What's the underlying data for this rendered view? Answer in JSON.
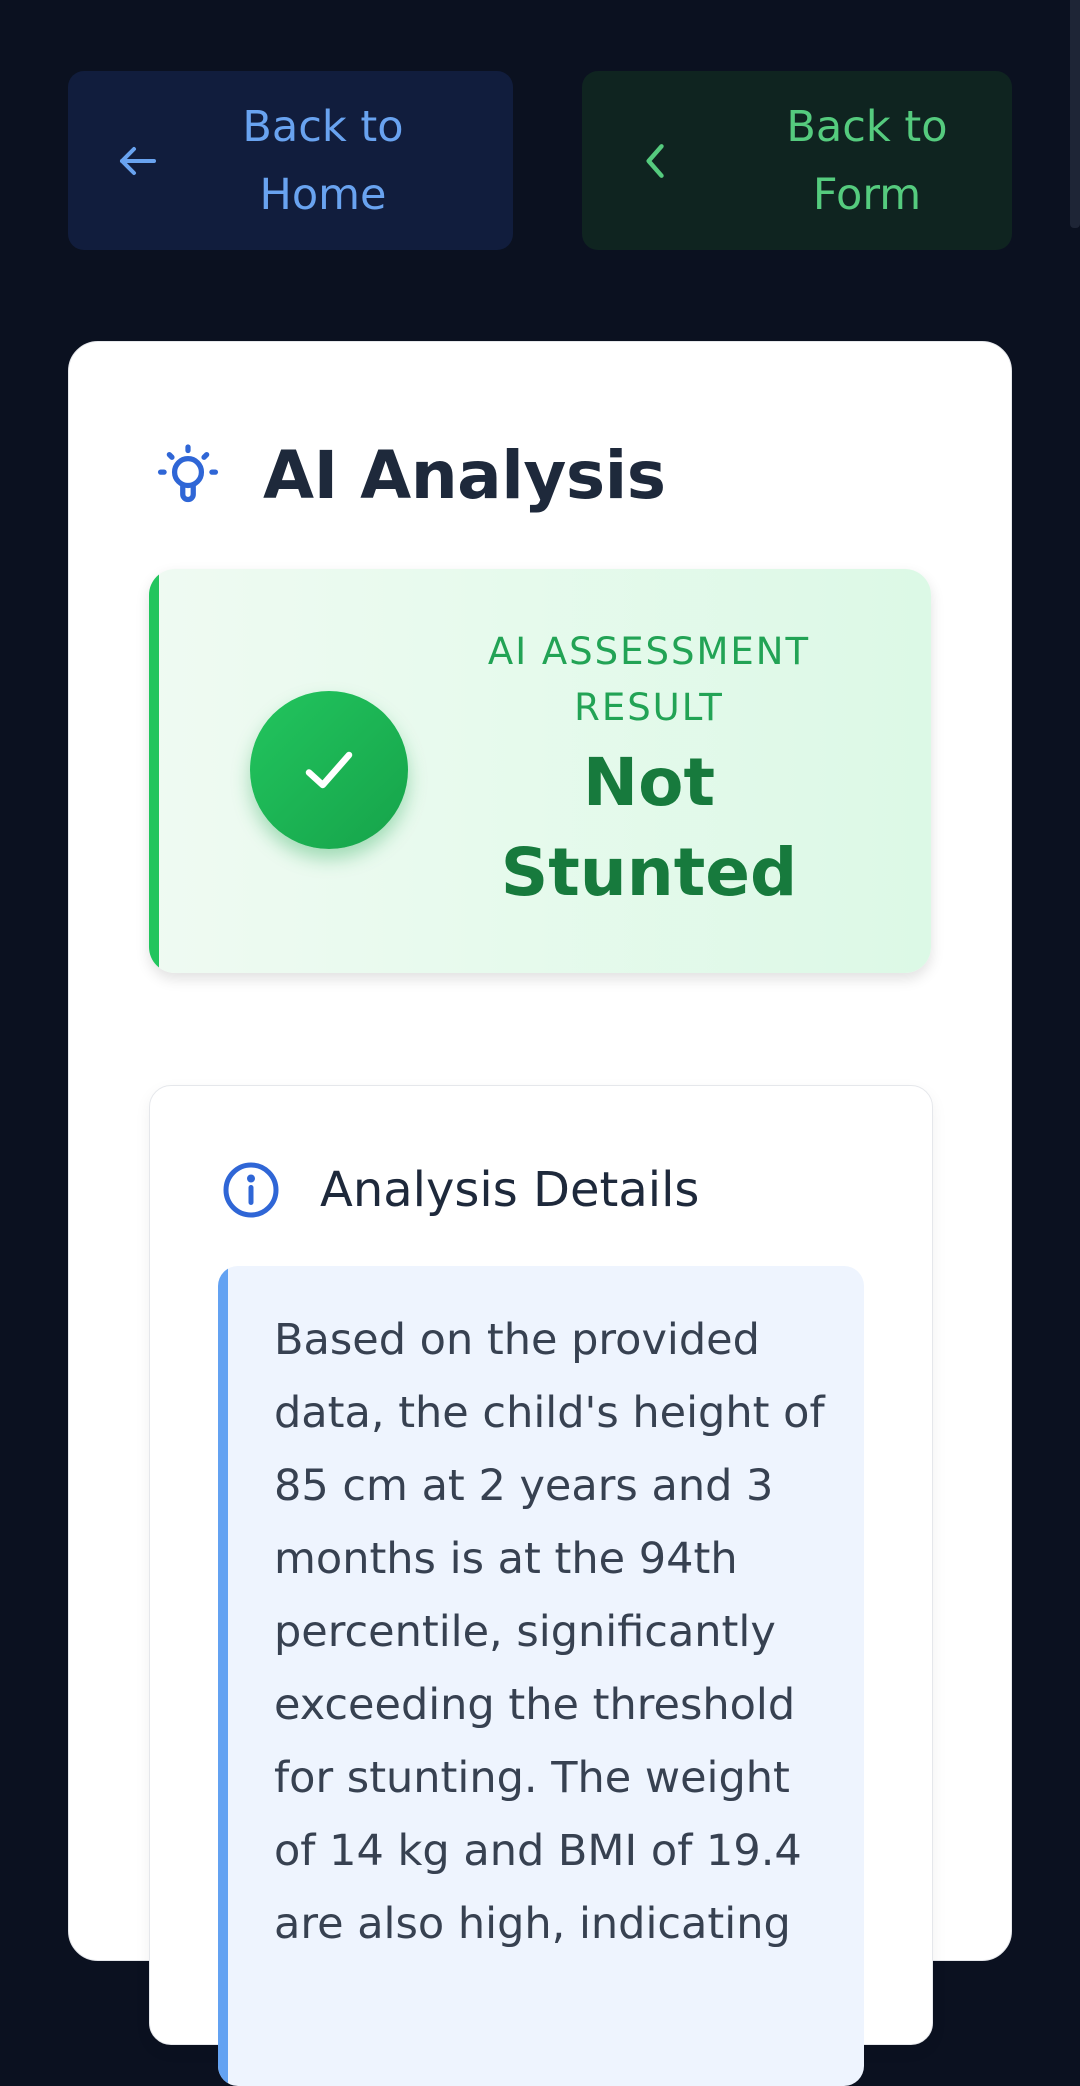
{
  "nav": {
    "back_home_label": "Back to Home",
    "back_form_label": "Back to Form"
  },
  "analysis": {
    "title": "AI Analysis",
    "result_label": "AI ASSESSMENT RESULT",
    "result_value": "Not Stunted",
    "details_title": "Analysis Details",
    "details_text": "Based on the provided data, the child's height of 85 cm at 2 years and 3 months is at the 94th percentile, significantly exceeding the threshold for stunting. The weight of 14 kg and BMI of 19.4 are also high, indicating"
  },
  "icons": {
    "back_home": "arrow-left-icon",
    "back_form": "chevron-left-icon",
    "title": "lightbulb-icon",
    "result": "check-icon",
    "details": "info-icon"
  },
  "colors": {
    "page_background": "#0b1120",
    "home_button_bg": "#111d3d",
    "home_button_text": "#69a3f0",
    "form_button_bg": "#0f2420",
    "form_button_text": "#55cb7e",
    "accent_blue": "#2f66d6",
    "success_green": "#22c55e",
    "result_text_green": "#177a3d",
    "details_bar_blue": "#63a2f2"
  }
}
